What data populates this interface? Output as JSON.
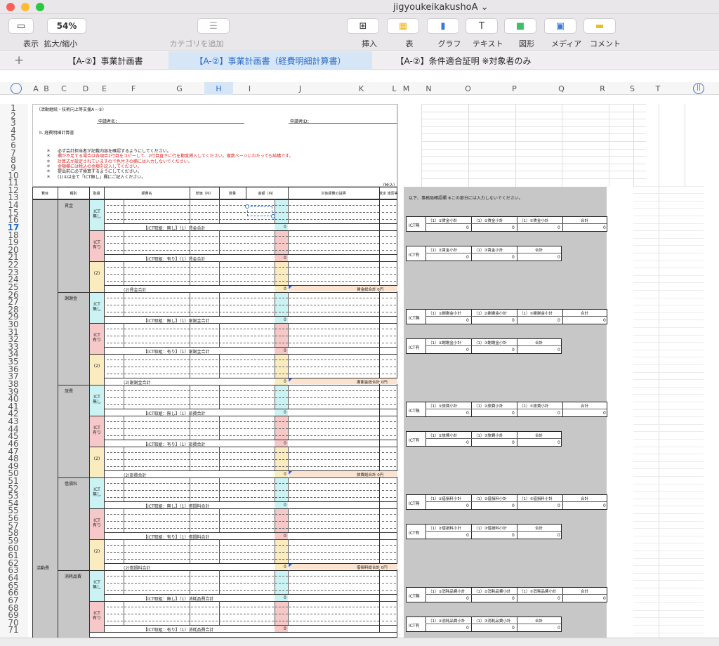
{
  "window": {
    "title": "jigyoukeikakushoA"
  },
  "toolbar": {
    "zoom": "54%",
    "items": [
      {
        "label": "表示",
        "icon": "view-icon"
      },
      {
        "label": "拡大/縮小",
        "icon": "zoom-icon"
      },
      {
        "label": "カテゴリを追加",
        "icon": "category-icon"
      },
      {
        "label": "挿入",
        "icon": "insert-icon"
      },
      {
        "label": "表",
        "icon": "table-icon"
      },
      {
        "label": "グラフ",
        "icon": "chart-icon"
      },
      {
        "label": "テキスト",
        "icon": "text-icon"
      },
      {
        "label": "図形",
        "icon": "shape-icon"
      },
      {
        "label": "メディア",
        "icon": "media-icon"
      },
      {
        "label": "コメント",
        "icon": "comment-icon"
      }
    ]
  },
  "tabs": [
    {
      "label": "【A-②】事業計画書"
    },
    {
      "label": "【A-②】事業計画書（経費明細計算書）"
    },
    {
      "label": "【A-②】条件適合証明 ※対象者のみ"
    }
  ],
  "columns": [
    "A",
    "B",
    "C",
    "D",
    "E",
    "F",
    "G",
    "H",
    "I",
    "J",
    "K",
    "L",
    "M",
    "N",
    "O",
    "P",
    "Q",
    "R",
    "S",
    "T"
  ],
  "form": {
    "header_note": "（活動継続・技術向上等支援A－②）",
    "applicant_name": "申請者名：",
    "applicant_id": "申請者ID：",
    "section_title": "II. 経費明細計算書",
    "notes": [
      "必ず会計担当者が記載内容を確認するようにしてください。",
      "欄が不足する場合は各項目2行目をコピーして、2行目直下に行を都度挿入してください。複数ページにわたっても結構です。",
      "計算式が設定されていますので色付きの欄には入力しないでください。",
      "金額欄には税込の金額を記入してください。",
      "提出前に必ず換算するようにしてください。",
      "(1)①は全て「ICT無し」欄にご記入ください。"
    ],
    "tax_note": "（税込）",
    "headers": [
      "費目",
      "種別",
      "取組",
      "経費名",
      "単価（円）",
      "数量",
      "金額（円）",
      "対象経費の説明",
      "数定\n適否等"
    ],
    "category_left": "活動費",
    "ict_none": "ICT\n無し",
    "ict_yes": "ICT\n有り",
    "two": "(2)",
    "zero": "0",
    "groups": [
      {
        "name": "賃金",
        "sub_none": "【ICT取組：無し】（1）賃金合計",
        "sub_yes": "【ICT取組：有り】（1）賃金合計",
        "sub2": "(2)賃金合計",
        "total": "賃金総合計 0円"
      },
      {
        "name": "謝謝金",
        "sub_none": "【ICT取組：無し】（1）謝謝金合計",
        "sub_yes": "【ICT取組：有り】（1）謝謝金合計",
        "sub2": "(2)謝謝金合計",
        "total": "謝謝金総合計 0円"
      },
      {
        "name": "旅費",
        "sub_none": "【ICT取組：無し】（1）旅費合計",
        "sub_yes": "【ICT取組：有り】（1）旅費合計",
        "sub2": "(2)旅費合計",
        "total": "旅費総合計 0円"
      },
      {
        "name": "借損料",
        "sub_none": "【ICT取組：無し】（1）借損料合計",
        "sub_yes": "【ICT取組：有り】（1）借損料合計",
        "sub2": "(2)借損料合計",
        "total": "借損料総合計 0円"
      },
      {
        "name": "消耗品費",
        "sub_none": "【ICT取組：無し】（1）消耗品費合計",
        "sub_yes": "【ICT取組：有り】（1）消耗品費合計",
        "sub2": "",
        "total": ""
      }
    ]
  },
  "right_panel": {
    "title": "以下、事務局確認欄 ※この部分には入力しないでください。",
    "ict_none": "ICT無",
    "ict_yes": "ICT有",
    "total_label": "合計",
    "groups": [
      {
        "n1": "（1）①賃金小計",
        "n2": "（1）②賃金小計",
        "n3": "（1）③賃金小計",
        "y2": "（1）②賃金小計",
        "y3": "（1）③賃金小計"
      },
      {
        "n1": "（1）①謝謝金小計",
        "n2": "（1）②謝謝金小計",
        "n3": "（1）③謝謝金小計",
        "y2": "（1）②謝謝金小計",
        "y3": "（1）③謝謝金小計"
      },
      {
        "n1": "（1）①旅費小計",
        "n2": "（1）②旅費小計",
        "n3": "（1）③旅費小計",
        "y2": "（1）②旅費小計",
        "y3": "（1）③旅費小計"
      },
      {
        "n1": "（1）①借損料小計",
        "n2": "（1）②借損料小計",
        "n3": "（1）③借損料小計",
        "y2": "（1）②借損料小計",
        "y3": "（1）③借損料小計"
      },
      {
        "n1": "（1）①消耗品費小計",
        "n2": "（1）②消耗品費小計",
        "n3": "（1）③消耗品費小計",
        "y2": "（1）②消耗品費小計",
        "y3": "（1）③消耗品費小計"
      }
    ]
  },
  "colors": {
    "cyan": "#ccf3f3",
    "pink": "#f6c8c8",
    "yellow": "#fbecc0",
    "peach": "#fbe3cf",
    "gray": "#c7c7c7",
    "selection": "#3b7ad9"
  }
}
